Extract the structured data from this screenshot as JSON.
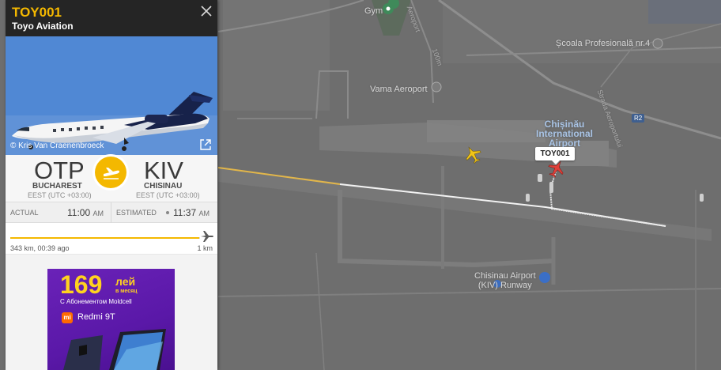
{
  "flight": {
    "number": "TOY001",
    "airline": "Toyo Aviation",
    "photo_credit": "© Kris Van Craenenbroeck"
  },
  "route": {
    "origin": {
      "code": "OTP",
      "city": "BUCHAREST",
      "tz": "EEST (UTC +03:00)"
    },
    "destination": {
      "code": "KIV",
      "city": "CHISINAU",
      "tz": "EEST (UTC +03:00)"
    }
  },
  "times": {
    "actual_label": "ACTUAL",
    "actual_time": "11:00",
    "actual_zone": "AM",
    "estimated_label": "ESTIMATED",
    "estimated_time": "11:37",
    "estimated_zone": "AM"
  },
  "progress": {
    "fraction": 0.997,
    "left_text": "343 km, 00:39 ago",
    "right_text": "1 km"
  },
  "ad": {
    "price": "169",
    "unit": "лей",
    "sub": "в месяц",
    "line": "С Абонементом Moldcell",
    "brand_icon": "mi",
    "model": "Redmi 9T"
  },
  "map": {
    "labels": {
      "gym": "Gym",
      "aeroport_street": "Aeroport",
      "scoala": "Școala Profesională nr.4",
      "vama": "Vama Aeroport",
      "airport_name_1": "Chișinău",
      "airport_name_2": "International",
      "airport_name_3": "Airport",
      "runway_1": "Chisinau Airport",
      "runway_2": "(KIV) Runway",
      "road_r2": "R2",
      "strada": "Strada Aeroportului",
      "road_100m": "100m"
    },
    "flight_tag": "TOY001"
  }
}
